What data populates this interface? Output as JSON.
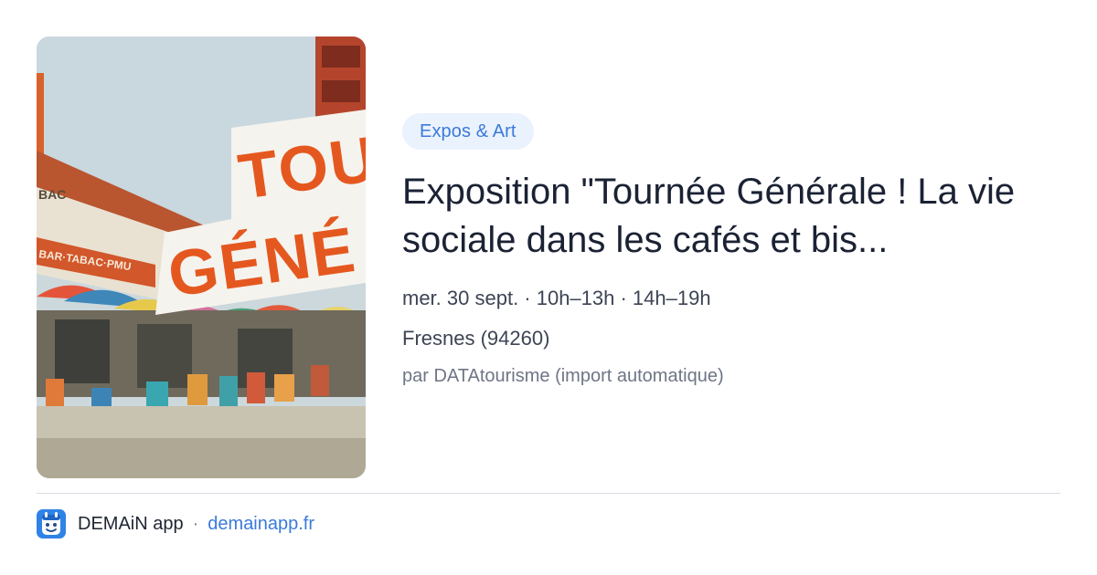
{
  "card": {
    "image": {
      "alt": "",
      "poster_lines": [
        "TOU",
        "GÉNÉ"
      ],
      "shop_sign": "BAR·TABAC·PMU",
      "awning_sign": "BAC"
    },
    "category": "Expos & Art",
    "title": "Exposition \"Tournée Générale ! La vie sociale dans les cafés et bis...",
    "date": "mer. 30 sept. · 10h–13h · 14h–19h",
    "location": "Fresnes (94260)",
    "source": "par DATAtourisme (import automatique)"
  },
  "footer": {
    "app_name": "DEMAiN app",
    "separator": "·",
    "link": "demainapp.fr",
    "logo_icon": "demain-app-logo-icon"
  },
  "colors": {
    "accent": "#3b7ad9",
    "chip_background": "#eaf2fd",
    "poster_orange": "#e4581f"
  }
}
